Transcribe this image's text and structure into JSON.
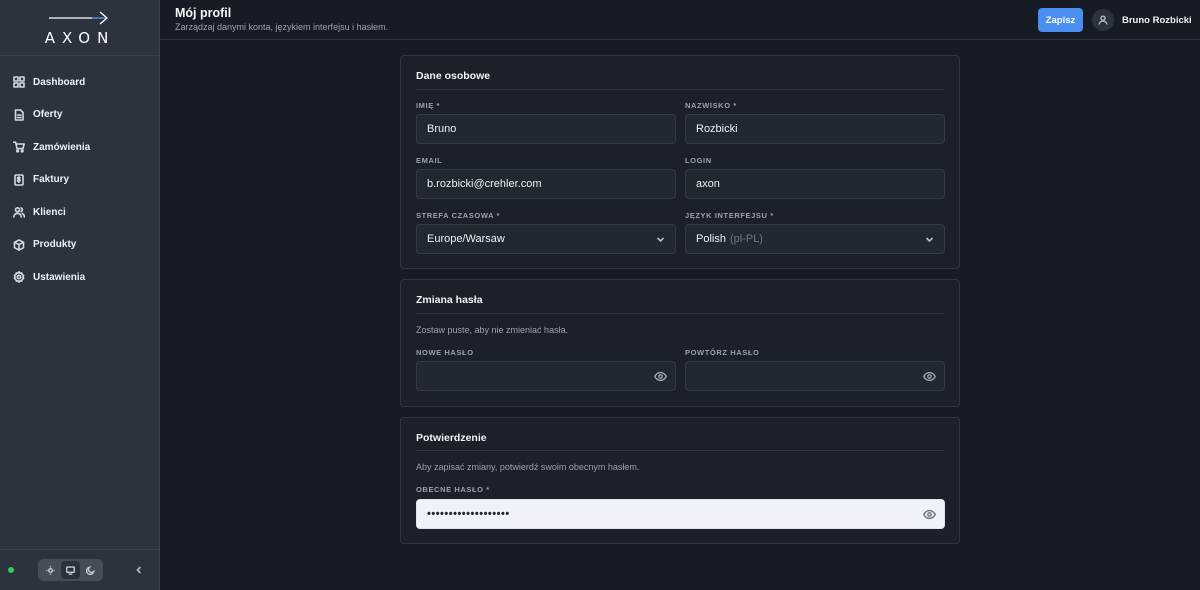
{
  "brand": {
    "name": "AXON"
  },
  "sidebar": {
    "items": [
      {
        "label": "Dashboard",
        "icon": "dashboard-icon"
      },
      {
        "label": "Oferty",
        "icon": "document-icon"
      },
      {
        "label": "Zamówienia",
        "icon": "cart-icon"
      },
      {
        "label": "Faktury",
        "icon": "invoice-icon"
      },
      {
        "label": "Klienci",
        "icon": "users-icon"
      },
      {
        "label": "Produkty",
        "icon": "box-icon"
      },
      {
        "label": "Ustawienia",
        "icon": "gear-icon"
      }
    ],
    "status": "online",
    "theme_modes": [
      "light",
      "system",
      "dark"
    ],
    "active_theme": "system"
  },
  "header": {
    "title": "Mój profil",
    "subtitle": "Zarządzaj danymi konta, językiem interfejsu i hasłem.",
    "save_label": "Zapisz",
    "user_name": "Bruno Rozbicki"
  },
  "personal": {
    "title": "Dane osobowe",
    "first_name_label": "IMIĘ *",
    "first_name_value": "Bruno",
    "last_name_label": "NAZWISKO *",
    "last_name_value": "Rozbicki",
    "email_label": "EMAIL",
    "email_value": "b.rozbicki@crehler.com",
    "login_label": "LOGIN",
    "login_value": "axon",
    "timezone_label": "STREFA CZASOWA *",
    "timezone_value": "Europe/Warsaw",
    "language_label": "JĘZYK INTERFEJSU *",
    "language_value": "Polish",
    "language_code": "(pl-PL)"
  },
  "password": {
    "title": "Zmiana hasła",
    "hint": "Zostaw puste, aby nie zmieniać hasła.",
    "new_label": "NOWE HASŁO",
    "repeat_label": "POWTÓRZ HASŁO"
  },
  "confirm": {
    "title": "Potwierdzenie",
    "hint": "Aby zapisać zmiany, potwierdź swoim obecnym hasłem.",
    "current_label": "OBECNE HASŁO *",
    "current_value": "•••••••••••••••••••"
  },
  "colors": {
    "accent": "#4a8ef0",
    "status_online": "#34c759",
    "background": "#171c24",
    "sidebar": "#2c333d"
  }
}
